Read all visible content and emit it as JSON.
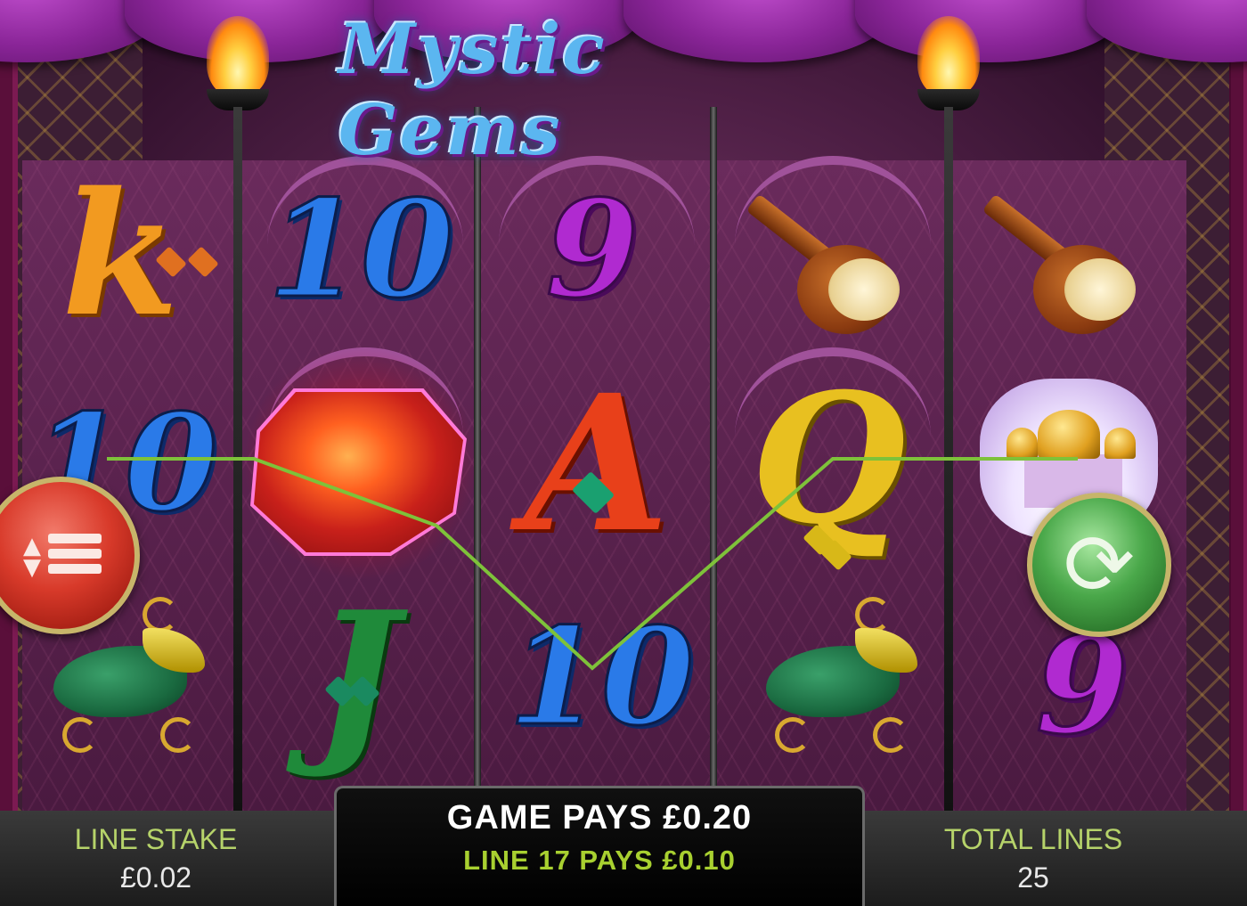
{
  "game": {
    "title": "Mystic Gems"
  },
  "reels": [
    {
      "symbols": [
        {
          "id": "k",
          "glyph": "k"
        },
        {
          "id": "10",
          "glyph": "10"
        },
        {
          "id": "slipper",
          "glyph": ""
        }
      ]
    },
    {
      "symbols": [
        {
          "id": "10",
          "glyph": "10"
        },
        {
          "id": "ruby",
          "glyph": ""
        },
        {
          "id": "j",
          "glyph": "J"
        }
      ]
    },
    {
      "symbols": [
        {
          "id": "9",
          "glyph": "9"
        },
        {
          "id": "a",
          "glyph": "A"
        },
        {
          "id": "10",
          "glyph": "10"
        }
      ]
    },
    {
      "symbols": [
        {
          "id": "instrument",
          "glyph": ""
        },
        {
          "id": "q",
          "glyph": "Q"
        },
        {
          "id": "slipper",
          "glyph": ""
        }
      ]
    },
    {
      "symbols": [
        {
          "id": "instrument",
          "glyph": ""
        },
        {
          "id": "palace",
          "glyph": ""
        },
        {
          "id": "9",
          "glyph": "9"
        }
      ]
    }
  ],
  "win_line": {
    "color": "#7ec23a"
  },
  "controls": {
    "menu_icon": "menu-icon",
    "spin_icon": "spin-icon"
  },
  "footer": {
    "line_stake_label": "LINE STAKE",
    "line_stake_value": "£0.02",
    "game_pays": "GAME PAYS £0.20",
    "line_pays": "LINE 17 PAYS £0.10",
    "total_lines_label": "TOTAL LINES",
    "total_lines_value": "25"
  }
}
